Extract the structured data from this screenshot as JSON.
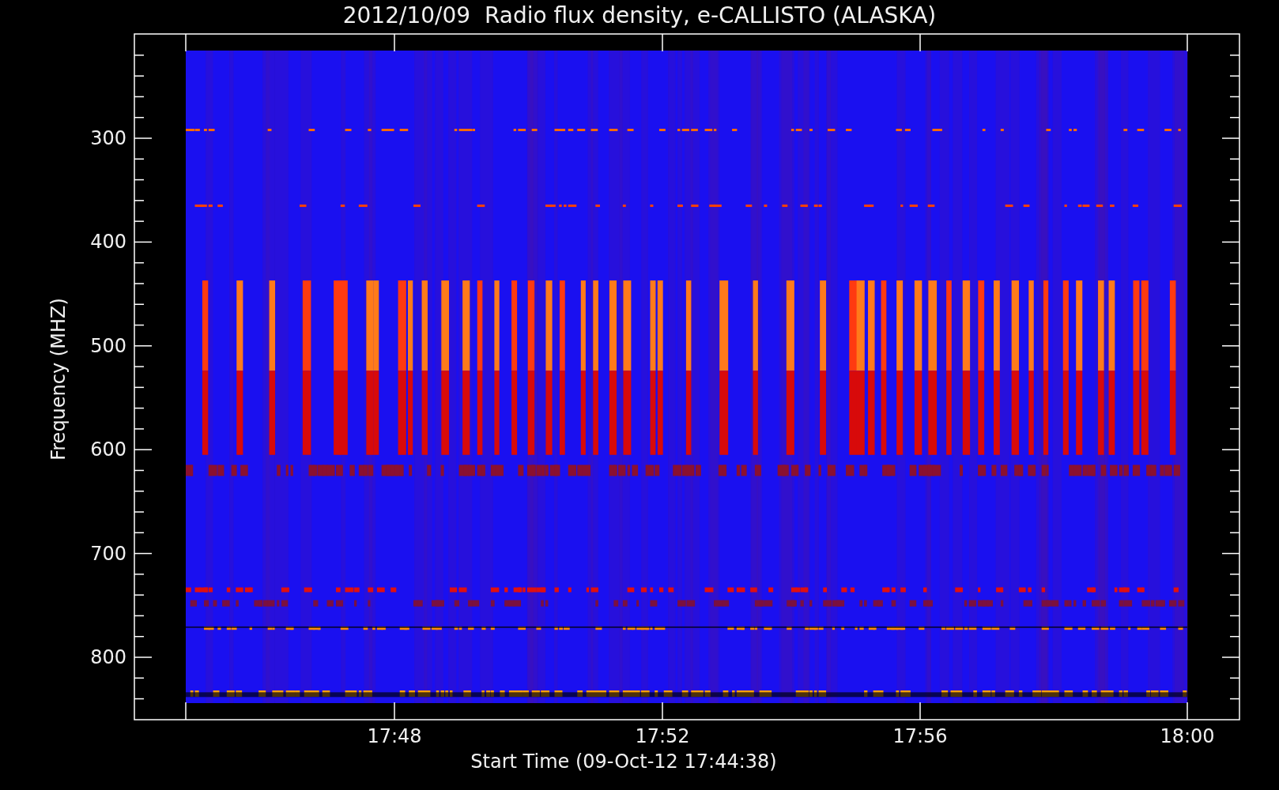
{
  "title": "2012/10/09  Radio flux density, e-CALLISTO (ALASKA)",
  "ylabel": "Frequency (MHZ)",
  "xlabel": "Start Time (09-Oct-12 17:44:38)",
  "yticks": [
    "300",
    "400",
    "500",
    "600",
    "700",
    "800"
  ],
  "xticks": [
    "17:48",
    "17:52",
    "17:56",
    "18:00"
  ]
}
